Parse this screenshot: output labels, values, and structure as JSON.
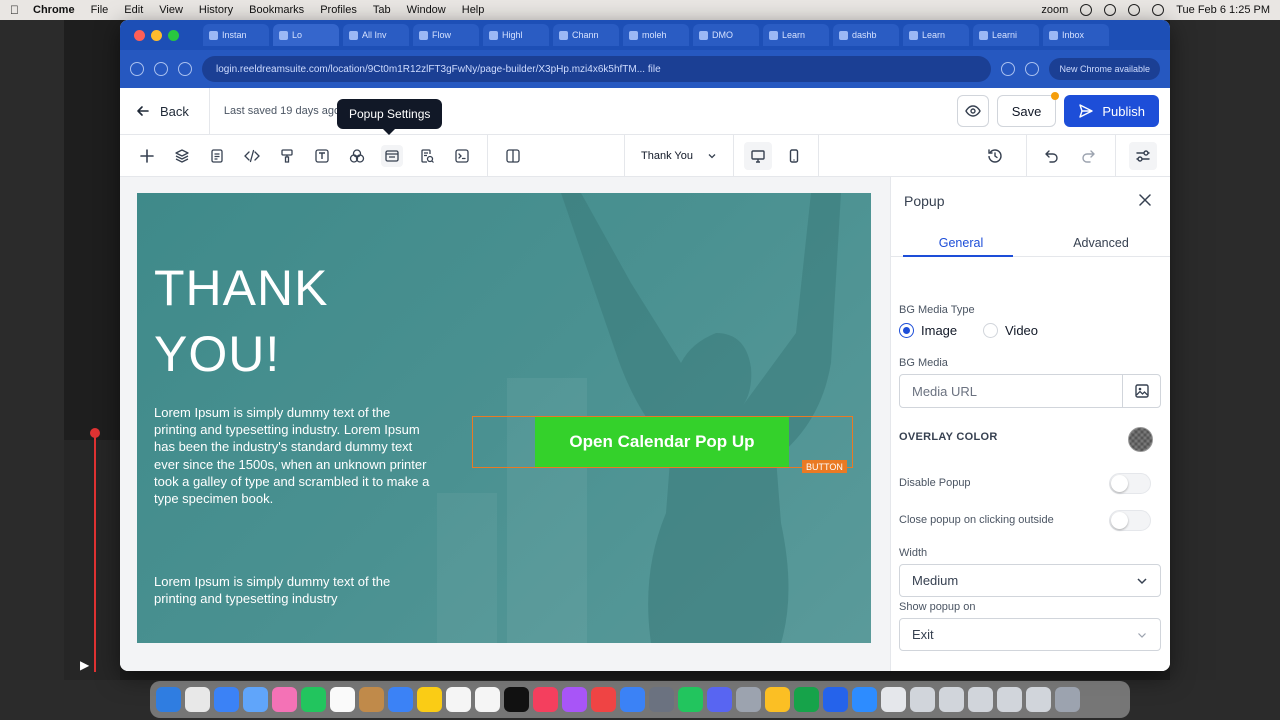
{
  "menubar": {
    "app": "Chrome",
    "items": [
      "File",
      "Edit",
      "View",
      "History",
      "Bookmarks",
      "Profiles",
      "Tab",
      "Window",
      "Help"
    ],
    "zoom": "zoom",
    "datetime": "Tue Feb 6  1:25 PM"
  },
  "browser": {
    "tabs": [
      "Instan",
      "Lo",
      "All Inv",
      "Flow",
      "Highl",
      "Chann",
      "moleh",
      "DMO",
      "Learn",
      "dashb",
      "Learn",
      "Learni",
      "Inbox"
    ],
    "url": "login.reeldreamsuite.com/location/9Ct0m1R12zlFT3gFwNy/page-builder/X3pHp.mzi4x6k5hfTM... file",
    "new_chrome": "New Chrome available"
  },
  "header": {
    "back_label": "Back",
    "last_saved": "Last saved 19 days ago",
    "tooltip": "Popup Settings",
    "save_label": "Save",
    "publish_label": "Publish"
  },
  "toolbar": {
    "page_selector": "Thank You"
  },
  "canvas": {
    "heading": "THANK YOU!",
    "paragraph1": "Lorem Ipsum is simply dummy text of the printing and typesetting industry. Lorem Ipsum has been the industry's standard dummy text ever since the 1500s, when an unknown printer took a galley of type and scrambled it to make a type specimen book.",
    "paragraph2": "Lorem Ipsum is simply dummy text of the printing and typesetting industry",
    "cta_label": "Open Calendar Pop Up",
    "badge": "BUTTON",
    "colors": {
      "cta": "#34d12b",
      "selection": "#ea7a24",
      "hero_bg": "#4a9191"
    }
  },
  "panel": {
    "title": "Popup",
    "tabs": [
      "General",
      "Advanced"
    ],
    "bg_media_type_label": "BG Media Type",
    "radio_image": "Image",
    "radio_video": "Video",
    "bg_media_label": "BG Media",
    "media_placeholder": "Media URL",
    "overlay_color_label": "OVERLAY COLOR",
    "disable_popup_label": "Disable Popup",
    "close_outside_label": "Close popup on clicking outside",
    "width_label": "Width",
    "width_value": "Medium",
    "show_on_label": "Show popup on",
    "show_on_value": "Exit",
    "accent": "#1d4ed8"
  }
}
